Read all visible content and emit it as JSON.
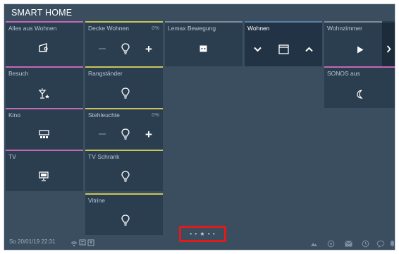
{
  "app": {
    "title": "SMART HOME"
  },
  "tiles": {
    "alles_aus_wohnen": {
      "label": "Alles aus Wohnen"
    },
    "decke_wohnen": {
      "label": "Decke Wohnen",
      "percent": "0%"
    },
    "lemax_bewegung": {
      "label": "Lemax Bewegung"
    },
    "wohnen": {
      "label": "Wohnen"
    },
    "wohnzimmer": {
      "label": "Wohnzimmer"
    },
    "besuch": {
      "label": "Besuch"
    },
    "rangstaender": {
      "label": "Rangständer"
    },
    "sonos_aus": {
      "label": "SONOS aus"
    },
    "kino": {
      "label": "Kino"
    },
    "stehleuchte": {
      "label": "Stehleuchte",
      "percent": "0%"
    },
    "tv": {
      "label": "TV"
    },
    "tv_schrank": {
      "label": "TV Schrank"
    },
    "vitrine": {
      "label": "Vitrine"
    }
  },
  "status": {
    "datetime": "So 20/01/19  22:31"
  },
  "page_indicator": {
    "dots": "• • ★ • •"
  },
  "icons": {
    "accent_pink": "#c268b5",
    "accent_yellow": "#c9c55a",
    "accent_blue": "#5c7fa6",
    "highlight": "#e01b1b"
  }
}
